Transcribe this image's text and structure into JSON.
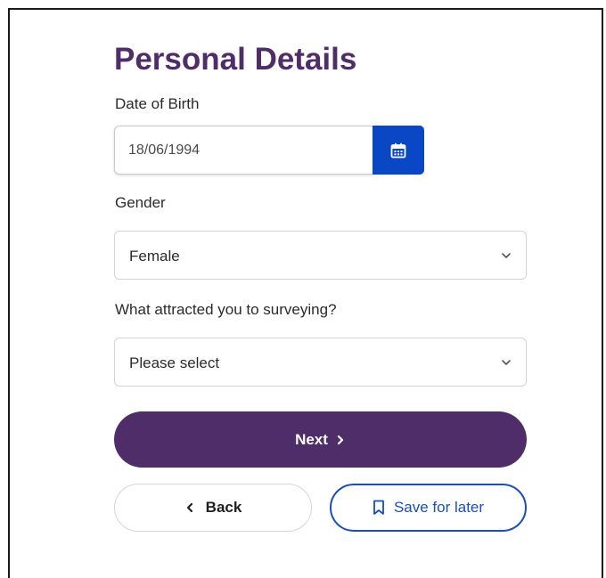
{
  "page": {
    "title": "Personal Details"
  },
  "fields": {
    "date_of_birth": {
      "label": "Date of Birth",
      "value": "18/06/1994",
      "button_icon": "calendar-icon"
    },
    "gender": {
      "label": "Gender",
      "value": "Female"
    },
    "surveying_attraction": {
      "label": "What attracted you to surveying?",
      "value": "Please select"
    }
  },
  "actions": {
    "next_label": "Next",
    "back_label": "Back",
    "save_label": "Save for later"
  },
  "colors": {
    "brand_purple": "#4f2d69",
    "accent_blue": "#0a47c4",
    "save_blue": "#1a4fb8"
  }
}
